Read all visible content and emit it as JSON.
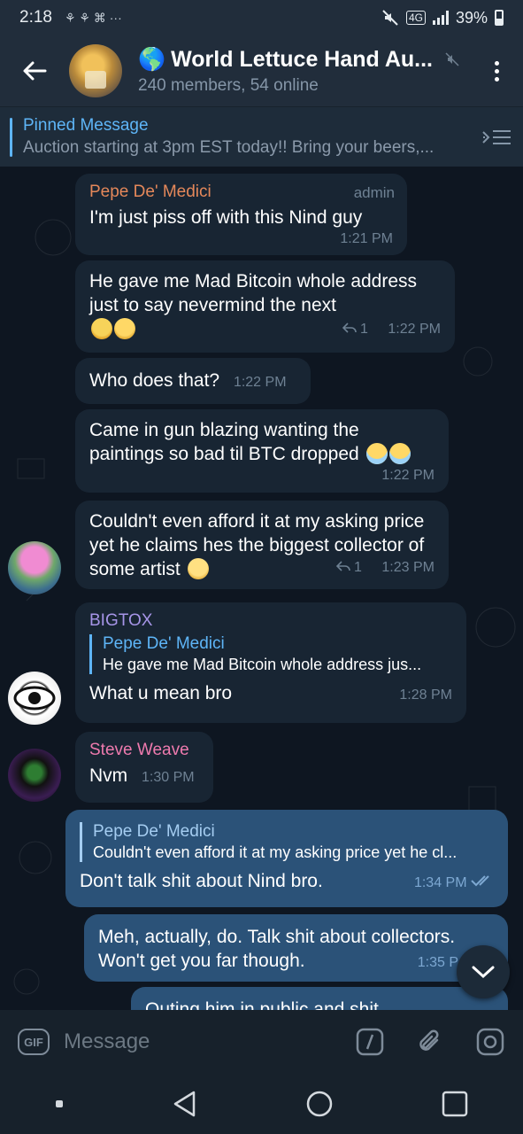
{
  "statusbar": {
    "time": "2:18",
    "notif_icons": "⚘ ⚘ ⌘ ···",
    "network": "4G",
    "battery": "39%"
  },
  "header": {
    "title_icon": "🌎",
    "title": "World Lettuce Hand Au...",
    "subtitle": "240 members, 54 online"
  },
  "pinned": {
    "title": "Pinned Message",
    "message": "Auction starting at 3pm EST today!! Bring your beers,..."
  },
  "messages": [
    {
      "sender": "Pepe De' Medici",
      "badge": "admin",
      "text": "I'm just piss off with this Nind guy",
      "time": "1:21 PM"
    },
    {
      "text": "He gave me Mad Bitcoin whole address just to say nevermind the next",
      "replies": "1",
      "time": "1:22 PM"
    },
    {
      "text": "Who does that?",
      "time": "1:22 PM"
    },
    {
      "text": "Came in gun blazing wanting the paintings so bad til BTC dropped",
      "time": "1:22 PM"
    },
    {
      "text": "Couldn't even afford it at my asking price yet he claims hes the biggest collector of some artist",
      "replies": "1",
      "time": "1:23 PM"
    },
    {
      "sender": "BIGTOX",
      "quote_name": "Pepe De' Medici",
      "quote_text": "He gave me Mad Bitcoin whole address jus...",
      "text": "What u mean bro",
      "time": "1:28 PM"
    },
    {
      "sender": "Steve Weave",
      "text": "Nvm",
      "time": "1:30 PM"
    },
    {
      "quote_name": "Pepe De' Medici",
      "quote_text": "Couldn't even afford it at my asking price yet he cl...",
      "text": "Don't talk shit about Nind bro.",
      "time": "1:34 PM"
    },
    {
      "text": "Meh, actually, do. Talk shit about collectors. Won't get you far though.",
      "time": "1:35 P"
    },
    {
      "text": "Outing him in public and shit"
    }
  ],
  "input": {
    "gif_label": "GIF",
    "placeholder": "Message"
  },
  "colors": {
    "background": "#0e1621",
    "header": "#212d3b",
    "incoming_bubble": "#182533",
    "outgoing_bubble": "#2b5278",
    "accent": "#5eb5f7",
    "pepe_name": "#e5885a",
    "bigtox_name": "#a695e7",
    "steve_name": "#ee7aae"
  }
}
